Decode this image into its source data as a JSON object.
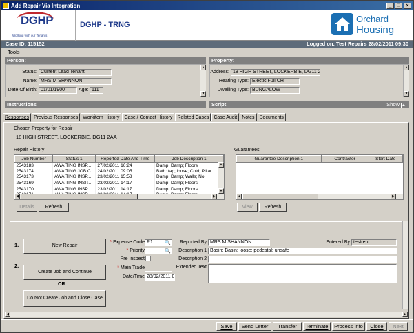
{
  "window": {
    "title": "Add Repair Via Integration"
  },
  "header": {
    "org_logo_text": "DGHP",
    "org_logo_tagline": "Working with our Tenants",
    "environment": "DGHP - TRNG",
    "brand_line1": "Orchard",
    "brand_line2": "Housing"
  },
  "casebar": {
    "case_id": "Case ID: 115152",
    "logged_on": "Logged on: Test Repairs  28/02/2011 09:30"
  },
  "menu": {
    "tools": "Tools"
  },
  "person": {
    "header": "Person:",
    "status_label": "Status:",
    "status": "Current Lead Tenant",
    "name_label": "Name:",
    "name": "MRS M SHANNON",
    "dob_label": "Date Of Birth:",
    "dob": "01/01/1900",
    "age_label": "Age:",
    "age": "111"
  },
  "property": {
    "header": "Property:",
    "address_label": "Address:",
    "address": "18 HIGH STREET, LOCKERBIE, DG11 2AA",
    "heating_label": "Heating Type:",
    "heating": "Electic Full CH",
    "dwelling_label": "Dwelling Type:",
    "dwelling": "BUNGALOW"
  },
  "sections": {
    "instructions": "Instructions",
    "script": "Script",
    "show": "Show"
  },
  "tabs": [
    "Responses",
    "Previous Responses",
    "Workitem History",
    "Case / Contact History",
    "Related Cases",
    "Case Audit",
    "Notes",
    "Documents"
  ],
  "chosen": {
    "label": "Chosen Property for Repair",
    "value": "18 HIGH STREET, LOCKERBIE, DG11 2AA"
  },
  "repair_history": {
    "label": "Repair History",
    "columns": [
      "Job Number",
      "Status 1",
      "Reported Date And Time",
      "Job Description 1"
    ],
    "rows": [
      [
        "2543183",
        "AWAITING INSP...",
        "27/02/2011 16:24",
        "Damp: Damp; Floors"
      ],
      [
        "2543174",
        "AWAITING JOB C...",
        "24/02/2011 09:05",
        "Bath: tap; loose; Cold; Pillar"
      ],
      [
        "2543173",
        "AWAITING INSP...",
        "23/02/2011 15:53",
        "Damp: Damp; Walls; No"
      ],
      [
        "2543169",
        "AWAITING INSP...",
        "23/02/2011 14:17",
        "Damp: Damp; Floors"
      ],
      [
        "2543170",
        "AWAITING INSP...",
        "23/02/2011 14:17",
        "Damp: Damp; Floors"
      ],
      [
        "2543171",
        "AWAITING INSP...",
        "23/02/2011 14:17",
        "Damp: Damp; Floors"
      ]
    ],
    "details_btn": "Details",
    "refresh_btn": "Refresh"
  },
  "guarantees": {
    "label": "Guarantees",
    "columns": [
      "Guarantee Description 1",
      "Contractor",
      "Start Date"
    ],
    "view_btn": "View",
    "refresh_btn": "Refresh"
  },
  "steps": {
    "step1": "1.",
    "new_repair": "New Repair",
    "step2": "2.",
    "create_job": "Create Job and Continue",
    "or": "OR",
    "no_create": "Do Not Create Job and Close Case"
  },
  "form": {
    "expense_label": "Expense Code",
    "expense": "R1",
    "priority_label": "Priority",
    "priority": "",
    "pre_inspect_label": "Pre Inspect",
    "main_trade_label": "Main Trade",
    "main_trade": "",
    "datetime_label": "Date/Time",
    "datetime": "28/02/2011 0",
    "reported_by_label": "Reported By",
    "reported_by": "MRS M SHANNON",
    "entered_by_label": "Entered By",
    "entered_by": "testrep",
    "desc1_label": "Description 1",
    "desc1": "Basin; Basin; loose; pedestal; unsafe",
    "desc2_label": "Description 2",
    "desc2": "",
    "extended_label": "Extended Text",
    "extended": ""
  },
  "bottom": {
    "save": "Save",
    "send_letter": "Send Letter",
    "transfer": "Transfer",
    "terminate": "Terminate",
    "process_info": "Process Info",
    "close": "Close",
    "next": "Next"
  },
  "colors": {
    "title_bar": "#0a246a",
    "case_bar": "#5d6b7a",
    "panel_header": "#808080",
    "brand_blue": "#1b6fb3",
    "dghp_red": "#c0282d"
  }
}
